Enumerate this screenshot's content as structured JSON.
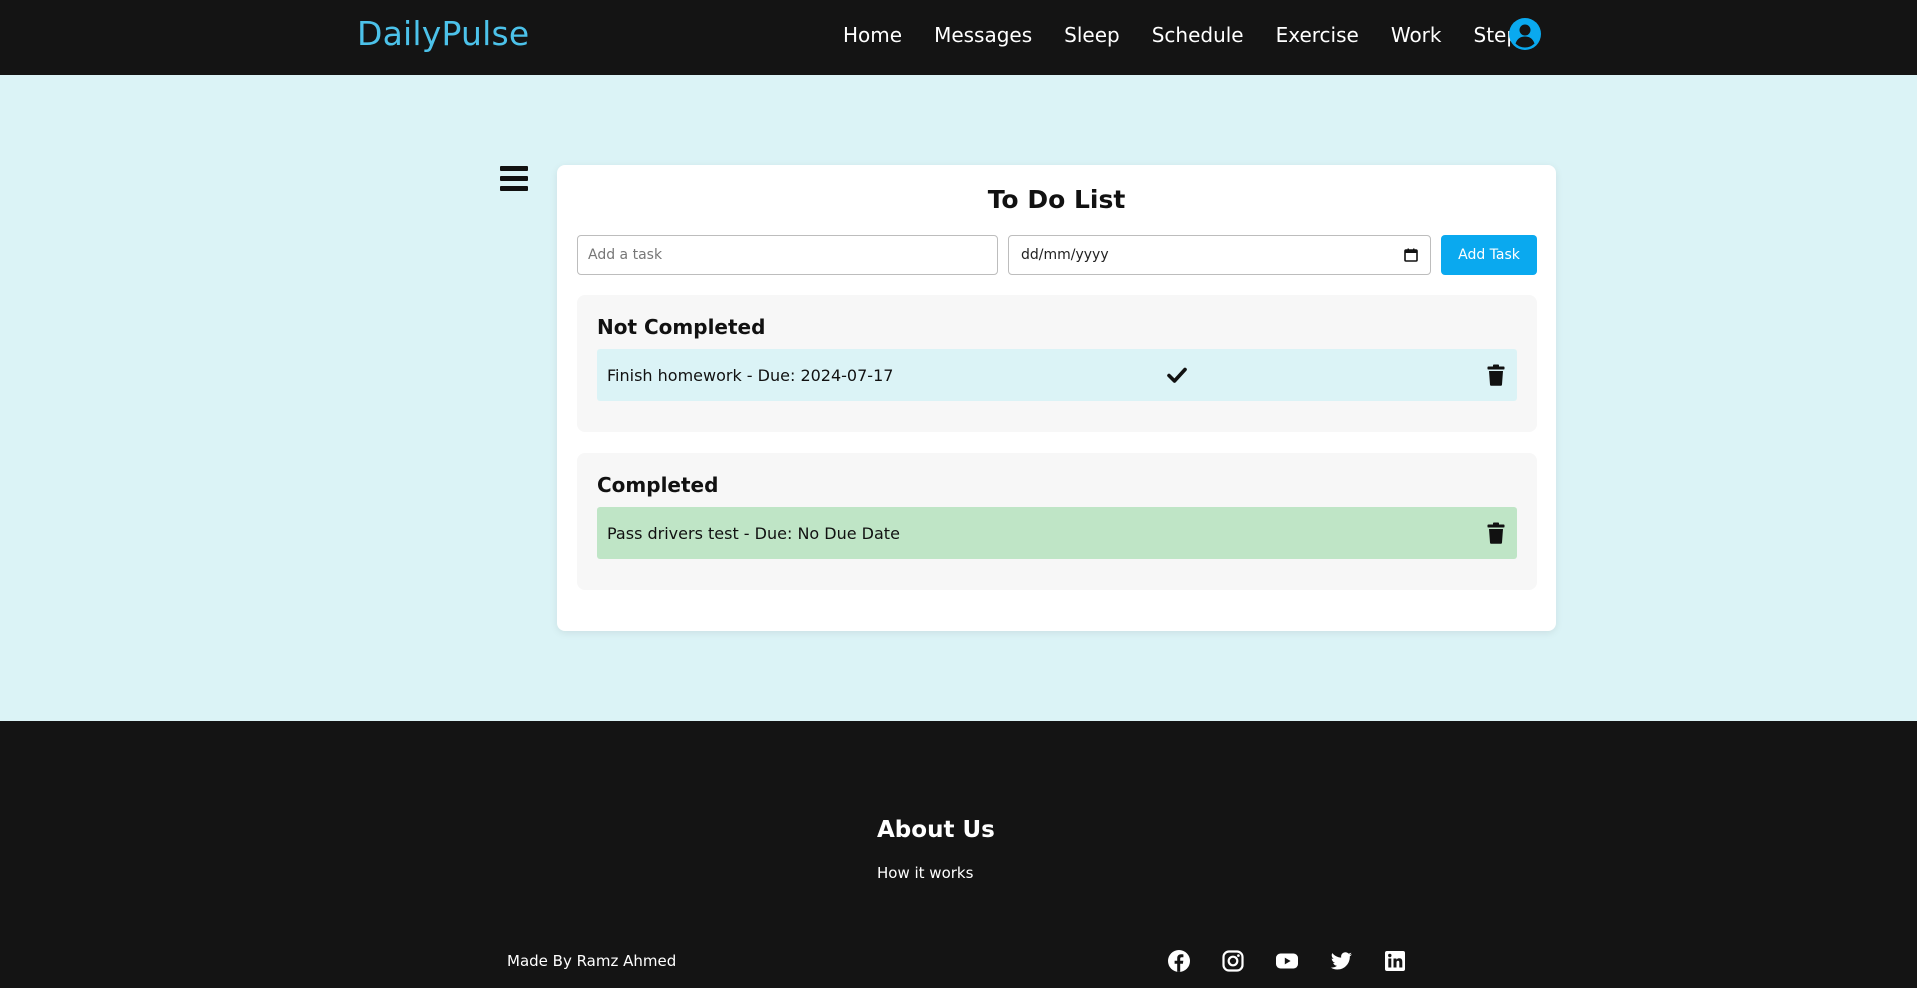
{
  "header": {
    "brand": "DailyPulse",
    "nav": [
      "Home",
      "Messages",
      "Sleep",
      "Schedule",
      "Exercise",
      "Work",
      "Steps"
    ],
    "avatar_icon": "user-circle-icon"
  },
  "sidebar": {
    "toggle_icon": "hamburger-menu-icon"
  },
  "todo": {
    "title": "To Do List",
    "task_placeholder": "Add a task",
    "date_placeholder": "dd/mm/yyyy",
    "add_label": "Add Task",
    "not_completed": {
      "title": "Not Completed",
      "items": [
        {
          "text": "Finish homework - Due: 2024-07-17"
        }
      ]
    },
    "completed": {
      "title": "Completed",
      "items": [
        {
          "text": "Pass drivers test - Due: No Due Date"
        }
      ]
    }
  },
  "footer": {
    "about_title": "About Us",
    "about_link": "How it works",
    "credit": "Made By Ramz Ahmed",
    "socials": [
      "facebook-icon",
      "instagram-icon",
      "youtube-icon",
      "twitter-icon",
      "linkedin-icon"
    ]
  },
  "colors": {
    "brand": "#4cc2ea",
    "accent": "#0aa9ef",
    "page_bg": "#dbf3f6",
    "completed_row": "#bfe5c6"
  }
}
